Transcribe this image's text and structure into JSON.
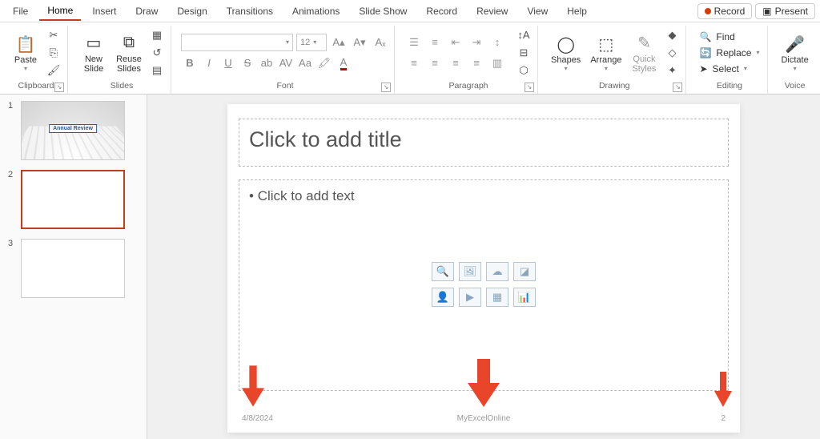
{
  "menubar": {
    "items": [
      "File",
      "Home",
      "Insert",
      "Draw",
      "Design",
      "Transitions",
      "Animations",
      "Slide Show",
      "Record",
      "Review",
      "View",
      "Help"
    ],
    "active_index": 1,
    "record_btn": "Record",
    "present_btn": "Present"
  },
  "ribbon": {
    "clipboard": {
      "label": "Clipboard",
      "paste": "Paste"
    },
    "slides": {
      "label": "Slides",
      "new_slide": "New\nSlide",
      "reuse_slides": "Reuse\nSlides"
    },
    "font": {
      "label": "Font",
      "font_name": "",
      "font_size": "12"
    },
    "paragraph": {
      "label": "Paragraph"
    },
    "drawing": {
      "label": "Drawing",
      "shapes": "Shapes",
      "arrange": "Arrange",
      "quick_styles": "Quick\nStyles"
    },
    "editing": {
      "label": "Editing",
      "find": "Find",
      "replace": "Replace",
      "select": "Select"
    },
    "voice": {
      "label": "Voice",
      "dictate": "Dictate"
    }
  },
  "thumbnails": {
    "items": [
      {
        "num": "1",
        "title": "Annual Review"
      },
      {
        "num": "2",
        "title": ""
      },
      {
        "num": "3",
        "title": ""
      }
    ],
    "selected_index": 1
  },
  "slide": {
    "title_placeholder": "Click to add title",
    "body_placeholder": "Click to add text",
    "footer_date": "4/8/2024",
    "footer_center": "MyExcelOnline",
    "footer_page": "2"
  }
}
